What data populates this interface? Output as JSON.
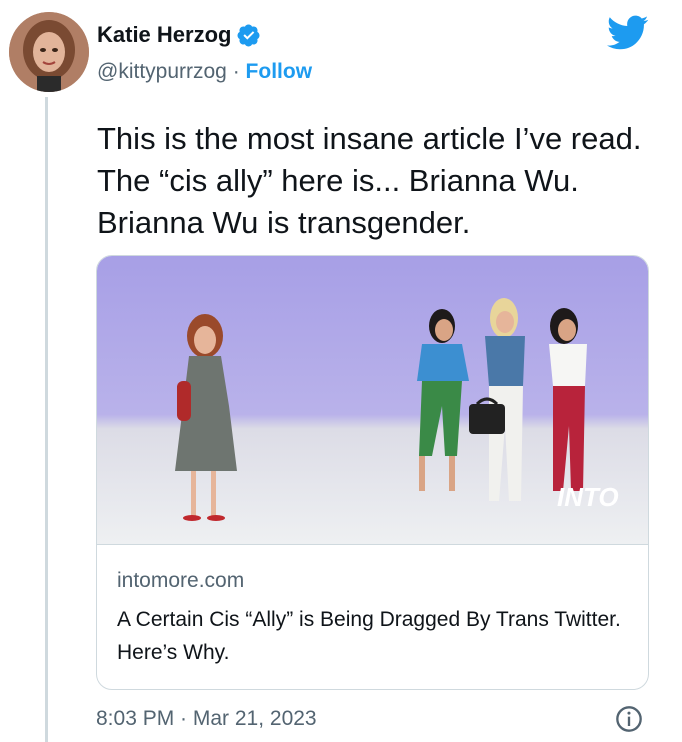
{
  "author": {
    "name": "Katie Herzog",
    "handle": "@kittypurrzog",
    "separator": "·",
    "follow_label": "Follow",
    "verified": true
  },
  "tweet": {
    "text": "This is the most insane article I’ve read. The “cis ally” here is... Brianna Wu. Brianna Wu is transgender."
  },
  "card": {
    "domain": "intomore.com",
    "title": "A Certain Cis “Ally” is Being Dragged By Trans Twitter. Here’s Why.",
    "image_watermark": "INTO"
  },
  "footer": {
    "timestamp": "8:03 PM · Mar 21, 2023"
  },
  "icons": {
    "brand": "twitter-bird-icon",
    "verified": "verified-badge-icon",
    "info": "info-icon"
  },
  "colors": {
    "accent": "#1d9bf0",
    "text": "#0f1419",
    "muted": "#536471",
    "border": "#cfd9de"
  }
}
